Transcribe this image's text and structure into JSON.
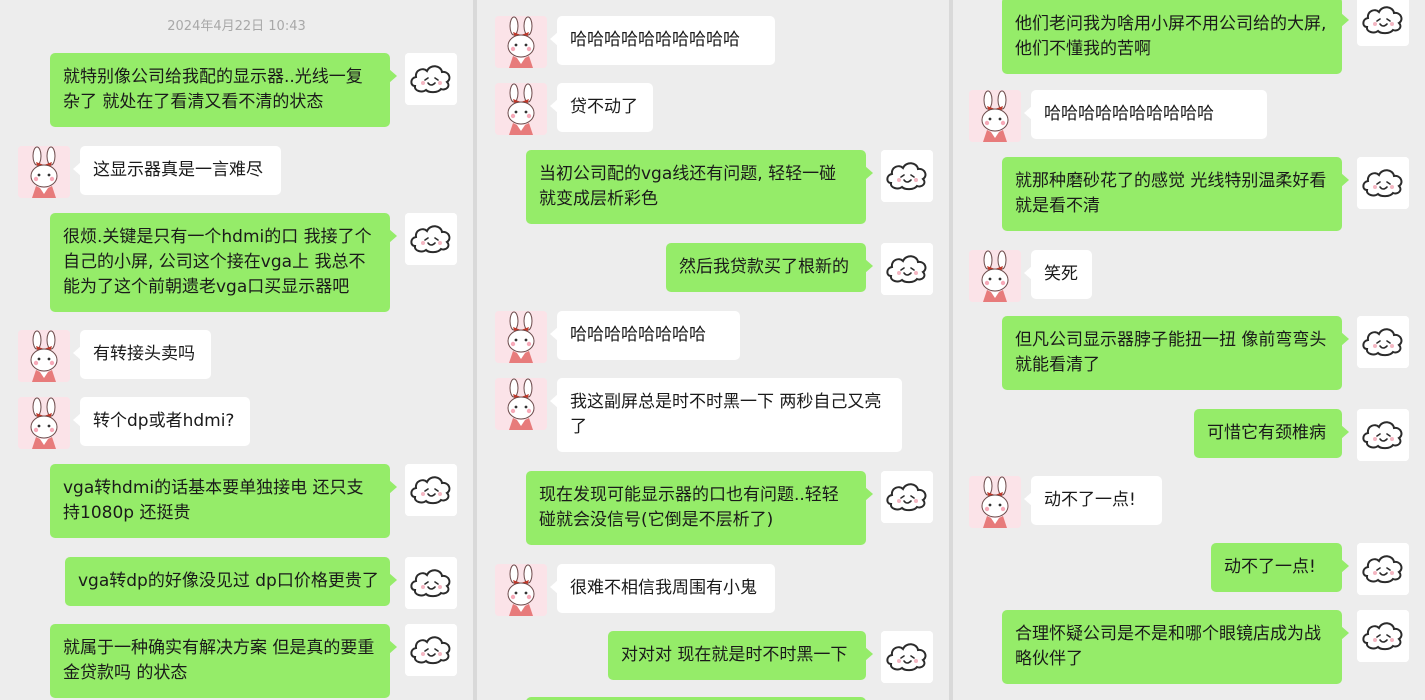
{
  "colors": {
    "sent_bubble": "#95ec69",
    "received_bubble": "#ffffff",
    "background": "#ededed"
  },
  "icons": {
    "sent_avatar": "cloud-face-icon",
    "received_avatar": "bunny-girl-icon"
  },
  "columns": [
    {
      "timestamp": "2024年4月22日 10:43",
      "messages": [
        {
          "from": "me",
          "text": "就特别像公司给我配的显示器..光线一复杂了 就处在了看清又看不清的状态"
        },
        {
          "from": "her",
          "text": "这显示器真是一言难尽"
        },
        {
          "from": "me",
          "text": "很烦.关键是只有一个hdmi的口 我接了个自己的小屏, 公司这个接在vga上 我总不能为了这个前朝遗老vga口买显示器吧"
        },
        {
          "from": "her",
          "text": "有转接头卖吗"
        },
        {
          "from": "her",
          "text": "转个dp或者hdmi?"
        },
        {
          "from": "me",
          "text": "vga转hdmi的话基本要单独接电 还只支持1080p 还挺贵"
        },
        {
          "from": "me",
          "text": "vga转dp的好像没见过 dp口价格更贵了"
        },
        {
          "from": "me",
          "text": "就属于一种确实有解决方案 但是真的要重金贷款吗 的状态"
        }
      ]
    },
    {
      "messages": [
        {
          "from": "her",
          "text": "哈哈哈哈哈哈哈哈哈哈"
        },
        {
          "from": "her",
          "text": "贷不动了"
        },
        {
          "from": "me",
          "text": "当初公司配的vga线还有问题, 轻轻一碰就变成层析彩色"
        },
        {
          "from": "me",
          "text": "然后我贷款买了根新的"
        },
        {
          "from": "her",
          "text": "哈哈哈哈哈哈哈哈"
        },
        {
          "from": "her",
          "text": "我这副屏总是时不时黑一下 两秒自己又亮了"
        },
        {
          "from": "me",
          "text": "现在发现可能显示器的口也有问题..轻轻碰就会没信号(它倒是不层析了)"
        },
        {
          "from": "her",
          "text": "很难不相信我周围有小鬼"
        },
        {
          "from": "me",
          "text": "对对对 现在就是时不时黑一下"
        }
      ]
    },
    {
      "messages": [
        {
          "from": "me",
          "text": "他们老问我为啥用小屏不用公司给的大屏, 他们不懂我的苦啊"
        },
        {
          "from": "her",
          "text": "哈哈哈哈哈哈哈哈哈哈"
        },
        {
          "from": "me",
          "text": "就那种磨砂花了的感觉 光线特别温柔好看 就是看不清"
        },
        {
          "from": "her",
          "text": "笑死"
        },
        {
          "from": "me",
          "text": "但凡公司显示器脖子能扭一扭 像前弯弯头 就能看清了"
        },
        {
          "from": "me",
          "text": "可惜它有颈椎病"
        },
        {
          "from": "her",
          "text": "动不了一点!"
        },
        {
          "from": "me",
          "text": "动不了一点!"
        },
        {
          "from": "me",
          "text": "合理怀疑公司是不是和哪个眼镜店成为战略伙伴了"
        }
      ]
    }
  ]
}
